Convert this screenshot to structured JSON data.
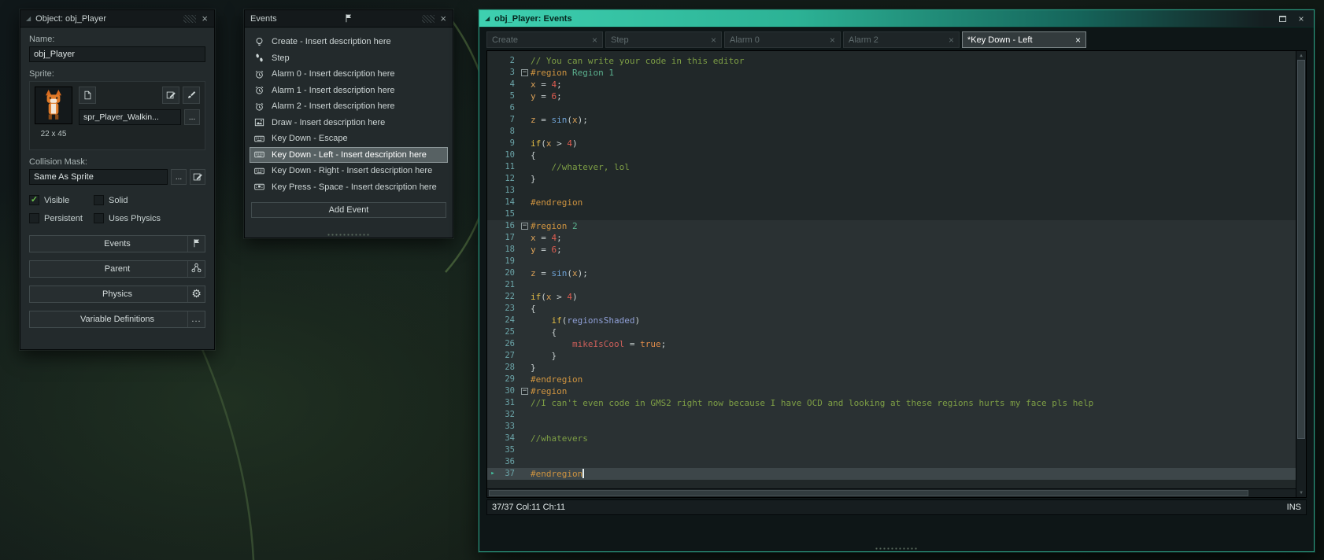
{
  "object_panel": {
    "title": "Object: obj_Player",
    "name_label": "Name:",
    "name_value": "obj_Player",
    "sprite_label": "Sprite:",
    "sprite_name": "spr_Player_Walkin...",
    "sprite_size": "22 x 45",
    "ellipsis_label": "...",
    "collision_mask_label": "Collision Mask:",
    "collision_mask_value": "Same As Sprite",
    "checkboxes": [
      {
        "label": "Visible",
        "checked": true
      },
      {
        "label": "Solid",
        "checked": false
      },
      {
        "label": "Persistent",
        "checked": false
      },
      {
        "label": "Uses Physics",
        "checked": false
      }
    ],
    "buttons": [
      {
        "label": "Events",
        "icon": "flag-icon"
      },
      {
        "label": "Parent",
        "icon": "parent-icon"
      },
      {
        "label": "Physics",
        "icon": "gear-icon"
      },
      {
        "label": "Variable Definitions",
        "icon": "ellipsis-icon"
      }
    ]
  },
  "events_panel": {
    "title": "Events",
    "add_button": "Add Event",
    "items": [
      {
        "label": "Create - Insert description here",
        "icon": "create-icon",
        "selected": false
      },
      {
        "label": "Step",
        "icon": "step-icon",
        "selected": false
      },
      {
        "label": "Alarm 0 - Insert description here",
        "icon": "alarm-icon",
        "selected": false
      },
      {
        "label": "Alarm 1 - Insert description here",
        "icon": "alarm-icon",
        "selected": false
      },
      {
        "label": "Alarm 2 - Insert description here",
        "icon": "alarm-icon",
        "selected": false
      },
      {
        "label": "Draw - Insert description here",
        "icon": "draw-icon",
        "selected": false
      },
      {
        "label": "Key Down - Escape",
        "icon": "keyboard-icon",
        "selected": false
      },
      {
        "label": "Key Down - Left - Insert description here",
        "icon": "keyboard-icon",
        "selected": true
      },
      {
        "label": "Key Down - Right - Insert description here",
        "icon": "keyboard-icon",
        "selected": false
      },
      {
        "label": "Key Press - Space - Insert description here",
        "icon": "keypress-icon",
        "selected": false
      }
    ]
  },
  "editor_window": {
    "title": "obj_Player: Events",
    "accent_color": "#2fbf9e",
    "tabs": [
      {
        "label": "Create",
        "active": false
      },
      {
        "label": "Step",
        "active": false
      },
      {
        "label": "Alarm 0",
        "active": false
      },
      {
        "label": "Alarm 2",
        "active": false
      },
      {
        "label": "*Key Down - Left",
        "active": true
      }
    ],
    "status_left": "37/37 Col:11 Ch:11",
    "status_right": "INS",
    "syntax_colors": {
      "comment": "#7d9e45",
      "region": "#cf9440",
      "region_name": "#5bb08e",
      "variable": "#d9a057",
      "number": "#e05d51",
      "plain": "#c8d0d0",
      "function": "#6fa3d6",
      "keyword": "#e3bd45",
      "identifier": "#8f9fd6",
      "field": "#cd5f5a",
      "boolean": "#de8a4a"
    },
    "code": {
      "lines": [
        {
          "n": 2,
          "t": [
            [
              "c",
              "// You can write your code in this editor"
            ]
          ]
        },
        {
          "n": 3,
          "f": 1,
          "t": [
            [
              "r",
              "#region"
            ],
            [
              "rn",
              " Region 1"
            ]
          ]
        },
        {
          "n": 4,
          "t": [
            [
              "v",
              "x"
            ],
            [
              "p",
              " = "
            ],
            [
              "n",
              "4"
            ],
            [
              "p",
              ";"
            ]
          ]
        },
        {
          "n": 5,
          "t": [
            [
              "v",
              "y"
            ],
            [
              "p",
              " = "
            ],
            [
              "n",
              "6"
            ],
            [
              "p",
              ";"
            ]
          ]
        },
        {
          "n": 6,
          "t": []
        },
        {
          "n": 7,
          "t": [
            [
              "v",
              "z"
            ],
            [
              "p",
              " = "
            ],
            [
              "fn",
              "sin"
            ],
            [
              "p",
              "("
            ],
            [
              "v",
              "x"
            ],
            [
              "p",
              ");"
            ]
          ]
        },
        {
          "n": 8,
          "t": []
        },
        {
          "n": 9,
          "t": [
            [
              "k",
              "if"
            ],
            [
              "p",
              "("
            ],
            [
              "v",
              "x"
            ],
            [
              "p",
              " > "
            ],
            [
              "n",
              "4"
            ],
            [
              "p",
              ")"
            ]
          ]
        },
        {
          "n": 10,
          "t": [
            [
              "p",
              "{"
            ]
          ]
        },
        {
          "n": 11,
          "t": [
            [
              "c",
              "    //whatever, lol"
            ]
          ]
        },
        {
          "n": 12,
          "t": [
            [
              "p",
              "}"
            ]
          ]
        },
        {
          "n": 13,
          "t": []
        },
        {
          "n": 14,
          "t": [
            [
              "r",
              "#endregion"
            ]
          ]
        },
        {
          "n": 15,
          "t": []
        },
        {
          "n": 16,
          "s": 1,
          "f": 1,
          "t": [
            [
              "r",
              "#region"
            ],
            [
              "rn",
              " 2"
            ]
          ]
        },
        {
          "n": 17,
          "s": 1,
          "t": [
            [
              "v",
              "x"
            ],
            [
              "p",
              " = "
            ],
            [
              "n",
              "4"
            ],
            [
              "p",
              ";"
            ]
          ]
        },
        {
          "n": 18,
          "s": 1,
          "t": [
            [
              "v",
              "y"
            ],
            [
              "p",
              " = "
            ],
            [
              "n",
              "6"
            ],
            [
              "p",
              ";"
            ]
          ]
        },
        {
          "n": 19,
          "s": 1,
          "t": []
        },
        {
          "n": 20,
          "s": 1,
          "t": [
            [
              "v",
              "z"
            ],
            [
              "p",
              " = "
            ],
            [
              "fn",
              "sin"
            ],
            [
              "p",
              "("
            ],
            [
              "v",
              "x"
            ],
            [
              "p",
              ");"
            ]
          ]
        },
        {
          "n": 21,
          "s": 1,
          "t": []
        },
        {
          "n": 22,
          "s": 1,
          "t": [
            [
              "k",
              "if"
            ],
            [
              "p",
              "("
            ],
            [
              "v",
              "x"
            ],
            [
              "p",
              " > "
            ],
            [
              "n",
              "4"
            ],
            [
              "p",
              ")"
            ]
          ]
        },
        {
          "n": 23,
          "s": 1,
          "t": [
            [
              "p",
              "{"
            ]
          ]
        },
        {
          "n": 24,
          "s": 1,
          "t": [
            [
              "p",
              "    "
            ],
            [
              "k",
              "if"
            ],
            [
              "p",
              "("
            ],
            [
              "i",
              "regionsShaded"
            ],
            [
              "p",
              ")"
            ]
          ]
        },
        {
          "n": 25,
          "s": 1,
          "t": [
            [
              "p",
              "    {"
            ]
          ]
        },
        {
          "n": 26,
          "s": 1,
          "t": [
            [
              "p",
              "        "
            ],
            [
              "m",
              "mikeIsCool"
            ],
            [
              "p",
              " = "
            ],
            [
              "b",
              "true"
            ],
            [
              "p",
              ";"
            ]
          ]
        },
        {
          "n": 27,
          "s": 1,
          "t": [
            [
              "p",
              "    }"
            ]
          ]
        },
        {
          "n": 28,
          "s": 1,
          "t": [
            [
              "p",
              "}"
            ]
          ]
        },
        {
          "n": 29,
          "s": 1,
          "t": [
            [
              "r",
              "#endregion"
            ]
          ]
        },
        {
          "n": 30,
          "s": 1,
          "f": 1,
          "t": [
            [
              "r",
              "#region"
            ]
          ]
        },
        {
          "n": 31,
          "s": 1,
          "t": [
            [
              "c",
              "//I can't even code in GMS2 right now because I have OCD and looking at these regions hurts my face pls help"
            ]
          ]
        },
        {
          "n": 32,
          "s": 1,
          "t": []
        },
        {
          "n": 33,
          "s": 1,
          "t": []
        },
        {
          "n": 34,
          "s": 1,
          "t": [
            [
              "c",
              "//whatevers"
            ]
          ]
        },
        {
          "n": 35,
          "s": 1,
          "t": []
        },
        {
          "n": 36,
          "s": 1,
          "t": []
        },
        {
          "n": 37,
          "s": 1,
          "cur": 1,
          "t": [
            [
              "r",
              "#endregion"
            ]
          ]
        }
      ]
    }
  }
}
